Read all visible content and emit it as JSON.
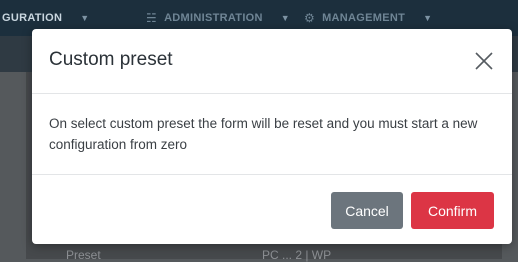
{
  "navbar": {
    "items": [
      {
        "label": "GURATION",
        "icon": ""
      },
      {
        "label": "ADMINISTRATION",
        "icon": "admin-icon"
      },
      {
        "label": "MANAGEMENT",
        "icon": "gear-icon"
      }
    ]
  },
  "background": {
    "field_label": "Preset",
    "field_value": "PC ... 2 | WP"
  },
  "modal": {
    "title": "Custom preset",
    "message": "On select custom preset the form will be reset and you must start a new configuration from zero",
    "cancel_label": "Cancel",
    "confirm_label": "Confirm"
  },
  "colors": {
    "confirm": "#dc3545",
    "cancel": "#6c757d",
    "navbar": "#1c2f3d"
  }
}
